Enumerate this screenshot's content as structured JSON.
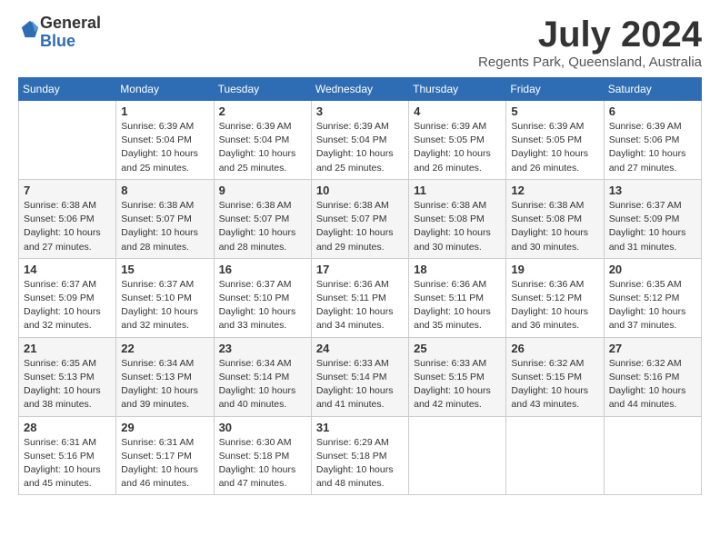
{
  "header": {
    "logo_general": "General",
    "logo_blue": "Blue",
    "month_title": "July 2024",
    "location": "Regents Park, Queensland, Australia"
  },
  "weekdays": [
    "Sunday",
    "Monday",
    "Tuesday",
    "Wednesday",
    "Thursday",
    "Friday",
    "Saturday"
  ],
  "weeks": [
    [
      {
        "day": "",
        "info": ""
      },
      {
        "day": "1",
        "info": "Sunrise: 6:39 AM\nSunset: 5:04 PM\nDaylight: 10 hours\nand 25 minutes."
      },
      {
        "day": "2",
        "info": "Sunrise: 6:39 AM\nSunset: 5:04 PM\nDaylight: 10 hours\nand 25 minutes."
      },
      {
        "day": "3",
        "info": "Sunrise: 6:39 AM\nSunset: 5:04 PM\nDaylight: 10 hours\nand 25 minutes."
      },
      {
        "day": "4",
        "info": "Sunrise: 6:39 AM\nSunset: 5:05 PM\nDaylight: 10 hours\nand 26 minutes."
      },
      {
        "day": "5",
        "info": "Sunrise: 6:39 AM\nSunset: 5:05 PM\nDaylight: 10 hours\nand 26 minutes."
      },
      {
        "day": "6",
        "info": "Sunrise: 6:39 AM\nSunset: 5:06 PM\nDaylight: 10 hours\nand 27 minutes."
      }
    ],
    [
      {
        "day": "7",
        "info": "Sunrise: 6:38 AM\nSunset: 5:06 PM\nDaylight: 10 hours\nand 27 minutes."
      },
      {
        "day": "8",
        "info": "Sunrise: 6:38 AM\nSunset: 5:07 PM\nDaylight: 10 hours\nand 28 minutes."
      },
      {
        "day": "9",
        "info": "Sunrise: 6:38 AM\nSunset: 5:07 PM\nDaylight: 10 hours\nand 28 minutes."
      },
      {
        "day": "10",
        "info": "Sunrise: 6:38 AM\nSunset: 5:07 PM\nDaylight: 10 hours\nand 29 minutes."
      },
      {
        "day": "11",
        "info": "Sunrise: 6:38 AM\nSunset: 5:08 PM\nDaylight: 10 hours\nand 30 minutes."
      },
      {
        "day": "12",
        "info": "Sunrise: 6:38 AM\nSunset: 5:08 PM\nDaylight: 10 hours\nand 30 minutes."
      },
      {
        "day": "13",
        "info": "Sunrise: 6:37 AM\nSunset: 5:09 PM\nDaylight: 10 hours\nand 31 minutes."
      }
    ],
    [
      {
        "day": "14",
        "info": "Sunrise: 6:37 AM\nSunset: 5:09 PM\nDaylight: 10 hours\nand 32 minutes."
      },
      {
        "day": "15",
        "info": "Sunrise: 6:37 AM\nSunset: 5:10 PM\nDaylight: 10 hours\nand 32 minutes."
      },
      {
        "day": "16",
        "info": "Sunrise: 6:37 AM\nSunset: 5:10 PM\nDaylight: 10 hours\nand 33 minutes."
      },
      {
        "day": "17",
        "info": "Sunrise: 6:36 AM\nSunset: 5:11 PM\nDaylight: 10 hours\nand 34 minutes."
      },
      {
        "day": "18",
        "info": "Sunrise: 6:36 AM\nSunset: 5:11 PM\nDaylight: 10 hours\nand 35 minutes."
      },
      {
        "day": "19",
        "info": "Sunrise: 6:36 AM\nSunset: 5:12 PM\nDaylight: 10 hours\nand 36 minutes."
      },
      {
        "day": "20",
        "info": "Sunrise: 6:35 AM\nSunset: 5:12 PM\nDaylight: 10 hours\nand 37 minutes."
      }
    ],
    [
      {
        "day": "21",
        "info": "Sunrise: 6:35 AM\nSunset: 5:13 PM\nDaylight: 10 hours\nand 38 minutes."
      },
      {
        "day": "22",
        "info": "Sunrise: 6:34 AM\nSunset: 5:13 PM\nDaylight: 10 hours\nand 39 minutes."
      },
      {
        "day": "23",
        "info": "Sunrise: 6:34 AM\nSunset: 5:14 PM\nDaylight: 10 hours\nand 40 minutes."
      },
      {
        "day": "24",
        "info": "Sunrise: 6:33 AM\nSunset: 5:14 PM\nDaylight: 10 hours\nand 41 minutes."
      },
      {
        "day": "25",
        "info": "Sunrise: 6:33 AM\nSunset: 5:15 PM\nDaylight: 10 hours\nand 42 minutes."
      },
      {
        "day": "26",
        "info": "Sunrise: 6:32 AM\nSunset: 5:15 PM\nDaylight: 10 hours\nand 43 minutes."
      },
      {
        "day": "27",
        "info": "Sunrise: 6:32 AM\nSunset: 5:16 PM\nDaylight: 10 hours\nand 44 minutes."
      }
    ],
    [
      {
        "day": "28",
        "info": "Sunrise: 6:31 AM\nSunset: 5:16 PM\nDaylight: 10 hours\nand 45 minutes."
      },
      {
        "day": "29",
        "info": "Sunrise: 6:31 AM\nSunset: 5:17 PM\nDaylight: 10 hours\nand 46 minutes."
      },
      {
        "day": "30",
        "info": "Sunrise: 6:30 AM\nSunset: 5:18 PM\nDaylight: 10 hours\nand 47 minutes."
      },
      {
        "day": "31",
        "info": "Sunrise: 6:29 AM\nSunset: 5:18 PM\nDaylight: 10 hours\nand 48 minutes."
      },
      {
        "day": "",
        "info": ""
      },
      {
        "day": "",
        "info": ""
      },
      {
        "day": "",
        "info": ""
      }
    ]
  ]
}
